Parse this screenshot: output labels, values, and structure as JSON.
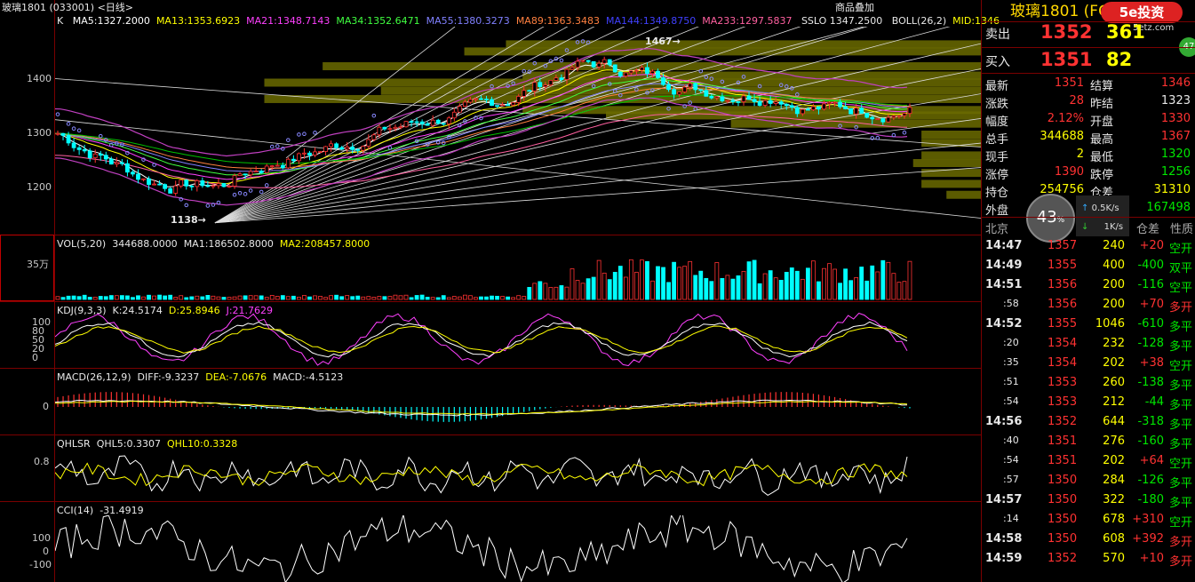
{
  "header": {
    "left_title": "玻璃1801 (033001)",
    "period": "<日线>",
    "menu": "商品叠加",
    "right_title": "玻璃1801 (FG801)",
    "logo_text": "5e投资",
    "logo_sub": "5etz.com",
    "badge": "47"
  },
  "main_legend": {
    "k": "K",
    "ma5": "MA5:1327.2000",
    "ma13": "MA13:1353.6923",
    "ma21": "MA21:1348.7143",
    "ma34": "MA34:1352.6471",
    "ma55": "MA55:1380.3273",
    "ma89": "MA89:1363.3483",
    "ma144": "MA144:1349.8750",
    "ma233": "MA233:1297.5837",
    "sslo": "SSLO  1347.2500",
    "boll": "BOLL(26,2)",
    "mid": "MID:1346"
  },
  "main_axis": {
    "ticks": [
      "1400",
      "1300",
      "1200"
    ],
    "high_label": "1467",
    "low_label": "1138",
    "high": 1467,
    "low": 1138
  },
  "vol": {
    "title": "VOL(5,20)",
    "v": "344688.0000",
    "ma1": "MA1:186502.8000",
    "ma2": "MA2:208457.8000",
    "axis": "35万"
  },
  "kdj": {
    "title": "KDJ(9,3,3)",
    "k": "K:24.5174",
    "d": "D:25.8946",
    "j": "J:21.7629",
    "ticks": [
      "100",
      "80",
      "50",
      "20",
      "0"
    ]
  },
  "macd": {
    "title": "MACD(26,12,9)",
    "diff": "DIFF:-9.3237",
    "dea": "DEA:-7.0676",
    "macd": "MACD:-4.5123",
    "ticks": [
      "0"
    ]
  },
  "qhlsr": {
    "title": "QHLSR",
    "q5": "QHL5:0.3307",
    "q10": "QHL10:0.3328",
    "ticks": [
      "0.8"
    ]
  },
  "cci": {
    "title": "CCI(14)",
    "v": "-31.4919",
    "ticks": [
      "100",
      "0",
      "-100"
    ]
  },
  "quote": {
    "sell_label": "卖出",
    "sell_price": "1352",
    "sell_vol": "361",
    "buy_label": "买入",
    "buy_price": "1351",
    "buy_vol": "82",
    "rows": [
      {
        "l1": "最新",
        "v1": "1351",
        "l2": "结算",
        "v2": "1346"
      },
      {
        "l1": "涨跌",
        "v1": "28",
        "l2": "昨结",
        "v2": "1323"
      },
      {
        "l1": "幅度",
        "v1": "2.12%",
        "l2": "开盘",
        "v2": "1330"
      },
      {
        "l1": "总手",
        "v1": "344688",
        "l2": "最高",
        "v2": "1367"
      },
      {
        "l1": "现手",
        "v1": "2",
        "l2": "最低",
        "v2": "1320"
      },
      {
        "l1": "涨停",
        "v1": "1390",
        "l2": "跌停",
        "v2": "1256"
      },
      {
        "l1": "持仓",
        "v1": "254756",
        "l2": "仓差",
        "v2": "31310"
      },
      {
        "l1": "外盘",
        "v1": "",
        "l2": "",
        "v2": "167498"
      }
    ],
    "net_pct": "43",
    "net_pct_unit": "%",
    "net_up": "0.5K/s",
    "net_down": "1K/s",
    "ticks_header": {
      "place": "北京",
      "warehouse": "仓差",
      "nature": "性质"
    }
  },
  "ticks": [
    {
      "t": "14:47",
      "p": "1357",
      "v": "240",
      "d": "+20",
      "n": "空开"
    },
    {
      "t": "14:49",
      "p": "1355",
      "v": "400",
      "d": "-400",
      "n": "双平"
    },
    {
      "t": "14:51",
      "p": "1356",
      "v": "200",
      "d": "-116",
      "n": "空平"
    },
    {
      "t": ":58",
      "p": "1356",
      "v": "200",
      "d": "+70",
      "n": "多开"
    },
    {
      "t": "14:52",
      "p": "1355",
      "v": "1046",
      "d": "-610",
      "n": "多平"
    },
    {
      "t": ":20",
      "p": "1354",
      "v": "232",
      "d": "-128",
      "n": "多平"
    },
    {
      "t": ":35",
      "p": "1354",
      "v": "202",
      "d": "+38",
      "n": "空开"
    },
    {
      "t": ":51",
      "p": "1353",
      "v": "260",
      "d": "-138",
      "n": "多平"
    },
    {
      "t": ":54",
      "p": "1353",
      "v": "212",
      "d": "-44",
      "n": "多平"
    },
    {
      "t": "14:56",
      "p": "1352",
      "v": "644",
      "d": "-318",
      "n": "多平"
    },
    {
      "t": ":40",
      "p": "1351",
      "v": "276",
      "d": "-160",
      "n": "多平"
    },
    {
      "t": ":54",
      "p": "1351",
      "v": "202",
      "d": "+64",
      "n": "空开"
    },
    {
      "t": ":57",
      "p": "1350",
      "v": "284",
      "d": "-126",
      "n": "多平"
    },
    {
      "t": "14:57",
      "p": "1350",
      "v": "322",
      "d": "-180",
      "n": "多平"
    },
    {
      "t": ":14",
      "p": "1350",
      "v": "678",
      "d": "+310",
      "n": "空开"
    },
    {
      "t": "14:58",
      "p": "1350",
      "v": "608",
      "d": "+392",
      "n": "多开"
    },
    {
      "t": "14:59",
      "p": "1352",
      "v": "570",
      "d": "+10",
      "n": "多开"
    }
  ],
  "colors": {
    "up": "#ff3232",
    "down": "#00ffff",
    "grid": "#7a0000",
    "olive": "#6b6b00"
  }
}
